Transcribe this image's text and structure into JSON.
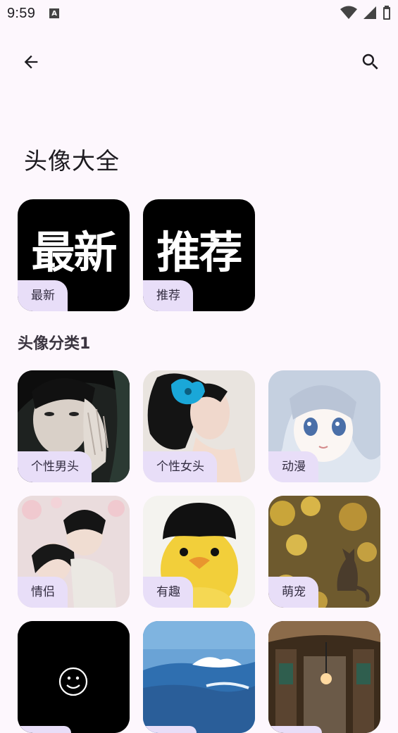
{
  "status": {
    "time": "9:59",
    "a_badge": "A"
  },
  "header": {
    "title": "头像大全"
  },
  "top_cards": [
    {
      "big": "最新",
      "label": "最新"
    },
    {
      "big": "推荐",
      "label": "推荐"
    }
  ],
  "section1": {
    "title": "头像分类1"
  },
  "categories": [
    {
      "label": "个性男头"
    },
    {
      "label": "个性女头"
    },
    {
      "label": "动漫"
    },
    {
      "label": "情侣"
    },
    {
      "label": "有趣"
    },
    {
      "label": "萌宠"
    }
  ],
  "colors": {
    "background": "#fdf7fd",
    "tag_bg": "#e8def8",
    "tag_text": "#332d41"
  }
}
